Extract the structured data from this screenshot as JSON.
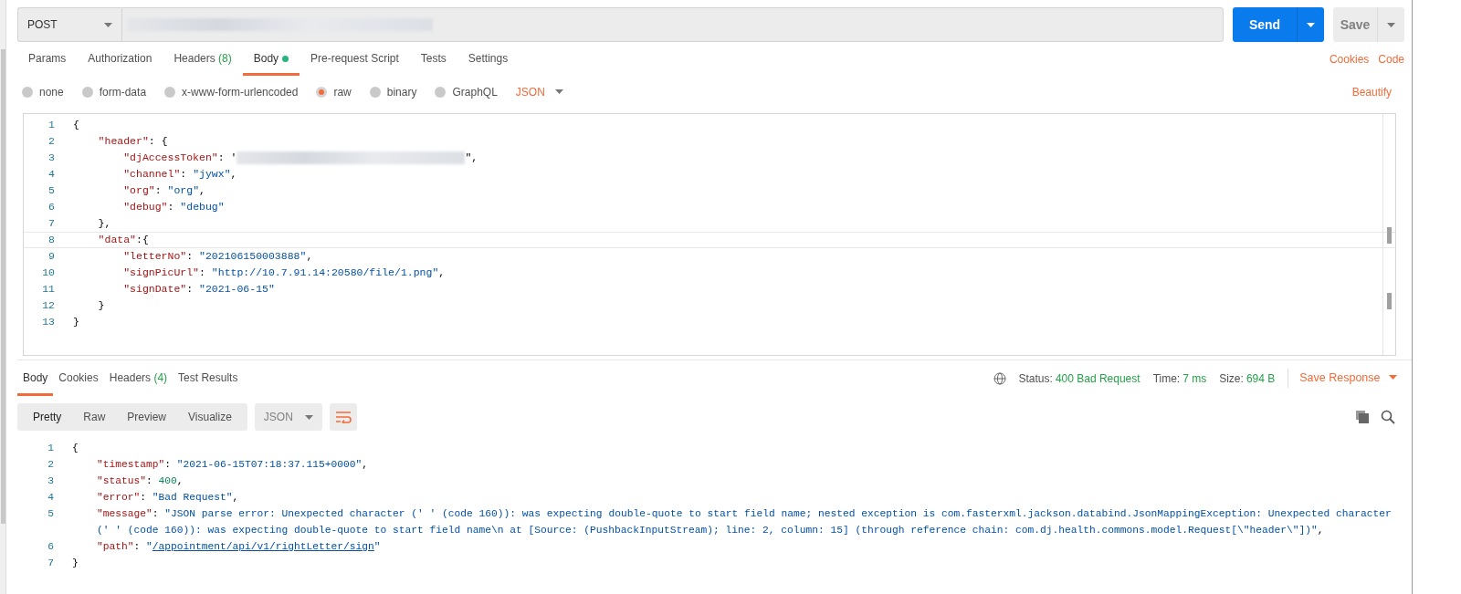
{
  "request": {
    "method": "POST",
    "send": "Send",
    "save": "Save"
  },
  "request_tabs": [
    {
      "label": "Params",
      "selected": false
    },
    {
      "label": "Authorization",
      "selected": false
    },
    {
      "label": "Headers",
      "count": "(8)",
      "selected": false
    },
    {
      "label": "Body",
      "selected": true,
      "dot": true
    },
    {
      "label": "Pre-request Script",
      "selected": false
    },
    {
      "label": "Tests",
      "selected": false
    },
    {
      "label": "Settings",
      "selected": false
    }
  ],
  "request_links": [
    "Cookies",
    "Code"
  ],
  "body_types": [
    {
      "label": "none",
      "selected": false
    },
    {
      "label": "form-data",
      "selected": false
    },
    {
      "label": "x-www-form-urlencoded",
      "selected": false
    },
    {
      "label": "raw",
      "selected": true
    },
    {
      "label": "binary",
      "selected": false
    },
    {
      "label": "GraphQL",
      "selected": false
    }
  ],
  "body_format": "JSON",
  "beautify": "Beautify",
  "request_body": [
    {
      "number": "1",
      "current": false,
      "tokens": [
        {
          "kind": "punct",
          "text": "{"
        }
      ]
    },
    {
      "number": "2",
      "current": false,
      "tokens": [
        {
          "kind": "key",
          "text": "    \"header\""
        },
        {
          "kind": "punct",
          "text": ": {"
        }
      ]
    },
    {
      "number": "3",
      "current": false,
      "tokens": [
        {
          "kind": "key",
          "text": "        \"djAccessToken\""
        },
        {
          "kind": "punct",
          "text": ": '"
        },
        {
          "kind": "blur"
        },
        {
          "kind": "punct",
          "text": "\","
        }
      ]
    },
    {
      "number": "4",
      "current": false,
      "tokens": [
        {
          "kind": "key",
          "text": "        \"channel\""
        },
        {
          "kind": "punct",
          "text": ": "
        },
        {
          "kind": "str",
          "text": "\"jywx\""
        },
        {
          "kind": "punct",
          "text": ","
        }
      ]
    },
    {
      "number": "5",
      "current": false,
      "tokens": [
        {
          "kind": "key",
          "text": "        \"org\""
        },
        {
          "kind": "punct",
          "text": ": "
        },
        {
          "kind": "str",
          "text": "\"org\""
        },
        {
          "kind": "punct",
          "text": ","
        }
      ]
    },
    {
      "number": "6",
      "current": false,
      "tokens": [
        {
          "kind": "key",
          "text": "        \"debug\""
        },
        {
          "kind": "punct",
          "text": ": "
        },
        {
          "kind": "str",
          "text": "\"debug\""
        }
      ]
    },
    {
      "number": "7",
      "current": false,
      "tokens": [
        {
          "kind": "punct",
          "text": "    },"
        }
      ]
    },
    {
      "number": "8",
      "current": true,
      "tokens": [
        {
          "kind": "key",
          "text": "    \"data\""
        },
        {
          "kind": "punct",
          "text": ":{"
        }
      ]
    },
    {
      "number": "9",
      "current": false,
      "tokens": [
        {
          "kind": "key",
          "text": "        \"letterNo\""
        },
        {
          "kind": "punct",
          "text": ": "
        },
        {
          "kind": "str",
          "text": "\"202106150003888\""
        },
        {
          "kind": "punct",
          "text": ","
        }
      ]
    },
    {
      "number": "10",
      "current": false,
      "tokens": [
        {
          "kind": "key",
          "text": "        \"signPicUrl\""
        },
        {
          "kind": "punct",
          "text": ": "
        },
        {
          "kind": "str",
          "text": "\"http://10.7.91.14:20580/file/1.png\""
        },
        {
          "kind": "punct",
          "text": ","
        }
      ]
    },
    {
      "number": "11",
      "current": false,
      "tokens": [
        {
          "kind": "key",
          "text": "        \"signDate\""
        },
        {
          "kind": "punct",
          "text": ": "
        },
        {
          "kind": "str",
          "text": "\"2021-06-15\""
        }
      ]
    },
    {
      "number": "12",
      "current": false,
      "tokens": [
        {
          "kind": "punct",
          "text": "    }"
        }
      ]
    },
    {
      "number": "13",
      "current": false,
      "tokens": [
        {
          "kind": "punct",
          "text": "}"
        }
      ]
    }
  ],
  "response_tabs": [
    {
      "label": "Body",
      "selected": true
    },
    {
      "label": "Cookies",
      "selected": false
    },
    {
      "label": "Headers",
      "count": "(4)",
      "selected": false
    },
    {
      "label": "Test Results",
      "selected": false
    }
  ],
  "response_meta": [
    {
      "label": "Status:",
      "value": "400 Bad Request"
    },
    {
      "label": "Time:",
      "value": "7 ms"
    },
    {
      "label": "Size:",
      "value": "694 B"
    }
  ],
  "save_response": "Save Response",
  "view_modes": [
    {
      "label": "Pretty",
      "selected": true
    },
    {
      "label": "Raw",
      "selected": false
    },
    {
      "label": "Preview",
      "selected": false
    },
    {
      "label": "Visualize",
      "selected": false
    }
  ],
  "response_format": "JSON",
  "response_body": [
    {
      "number": "1",
      "tokens": [
        {
          "kind": "punct",
          "text": "{"
        }
      ]
    },
    {
      "number": "2",
      "tokens": [
        {
          "kind": "key",
          "text": "    \"timestamp\""
        },
        {
          "kind": "punct",
          "text": ": "
        },
        {
          "kind": "str",
          "text": "\"2021-06-15T07:18:37.115+0000\""
        },
        {
          "kind": "punct",
          "text": ","
        }
      ]
    },
    {
      "number": "3",
      "tokens": [
        {
          "kind": "key",
          "text": "    \"status\""
        },
        {
          "kind": "punct",
          "text": ": "
        },
        {
          "kind": "num",
          "text": "400"
        },
        {
          "kind": "punct",
          "text": ","
        }
      ]
    },
    {
      "number": "4",
      "tokens": [
        {
          "kind": "key",
          "text": "    \"error\""
        },
        {
          "kind": "punct",
          "text": ": "
        },
        {
          "kind": "str",
          "text": "\"Bad Request\""
        },
        {
          "kind": "punct",
          "text": ","
        }
      ]
    },
    {
      "number": "5",
      "tokens": [
        {
          "kind": "key",
          "text": "    \"message\""
        },
        {
          "kind": "punct",
          "text": ": "
        },
        {
          "kind": "str",
          "text": "\"JSON parse error: Unexpected character (' ' (code 160)): was expecting double-quote to start field name; nested exception is com.fasterxml.jackson.databind.JsonMappingException: Unexpected character (' ' (code 160)): was expecting double-quote to start field name\\n at [Source: (PushbackInputStream); line: 2, column: 15] (through reference chain: com.dj.health.commons.model.Request[\\\"header\\\"])\""
        },
        {
          "kind": "punct",
          "text": ","
        }
      ]
    },
    {
      "number": "6",
      "tokens": [
        {
          "kind": "key",
          "text": "    \"path\""
        },
        {
          "kind": "punct",
          "text": ": "
        },
        {
          "kind": "str",
          "text": "\""
        },
        {
          "kind": "link",
          "text": "/appointment/api/v1/rightLetter/sign"
        },
        {
          "kind": "str",
          "text": "\""
        }
      ]
    },
    {
      "number": "7",
      "tokens": [
        {
          "kind": "punct",
          "text": "}"
        }
      ]
    }
  ]
}
